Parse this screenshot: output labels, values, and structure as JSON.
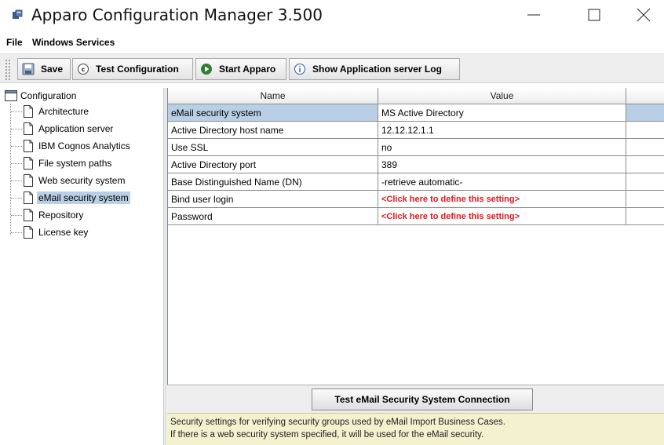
{
  "window": {
    "title": "Apparo Configuration Manager 3.500",
    "icon": "apparo-app-icon"
  },
  "menu": {
    "items": [
      {
        "label": "File"
      },
      {
        "label": "Windows Services"
      }
    ]
  },
  "toolbar": {
    "buttons": [
      {
        "label": "Save",
        "icon": "save-icon"
      },
      {
        "label": "Test Configuration",
        "icon": "test-icon"
      },
      {
        "label": "Start Apparo",
        "icon": "play-icon"
      },
      {
        "label": "Show Application server Log",
        "icon": "info-icon"
      }
    ]
  },
  "tree": {
    "root": "Configuration",
    "items": [
      {
        "label": "Architecture"
      },
      {
        "label": "Application server"
      },
      {
        "label": "IBM Cognos Analytics"
      },
      {
        "label": "File system paths"
      },
      {
        "label": "Web security system"
      },
      {
        "label": "eMail security system",
        "selected": true
      },
      {
        "label": "Repository"
      },
      {
        "label": "License key"
      }
    ]
  },
  "table": {
    "columns": [
      "Name",
      "Value",
      ""
    ],
    "rows": [
      {
        "name": "eMail security system",
        "value": "MS Active Directory",
        "selected": true
      },
      {
        "name": "Active Directory host name",
        "value": "12.12.12.1.1"
      },
      {
        "name": "Use SSL",
        "value": "no"
      },
      {
        "name": "Active Directory port",
        "value": "389"
      },
      {
        "name": "Base Distinguished Name (DN)",
        "value": "-retrieve automatic-"
      },
      {
        "name": "Bind user login",
        "value": "<Click here to define this setting>",
        "undefined": true
      },
      {
        "name": "Password",
        "value": "<Click here to define this setting>",
        "undefined": true
      }
    ]
  },
  "test_button": {
    "label": "Test eMail Security System Connection"
  },
  "info": {
    "line1": "Security settings for verifying security groups used by eMail Import Business Cases.",
    "line2": "If there is a web security system specified, it will be used for the eMail security."
  },
  "colors": {
    "selection": "#b8cfe5",
    "undefined_value": "#e8141b",
    "info_background": "#f4f1cf"
  }
}
